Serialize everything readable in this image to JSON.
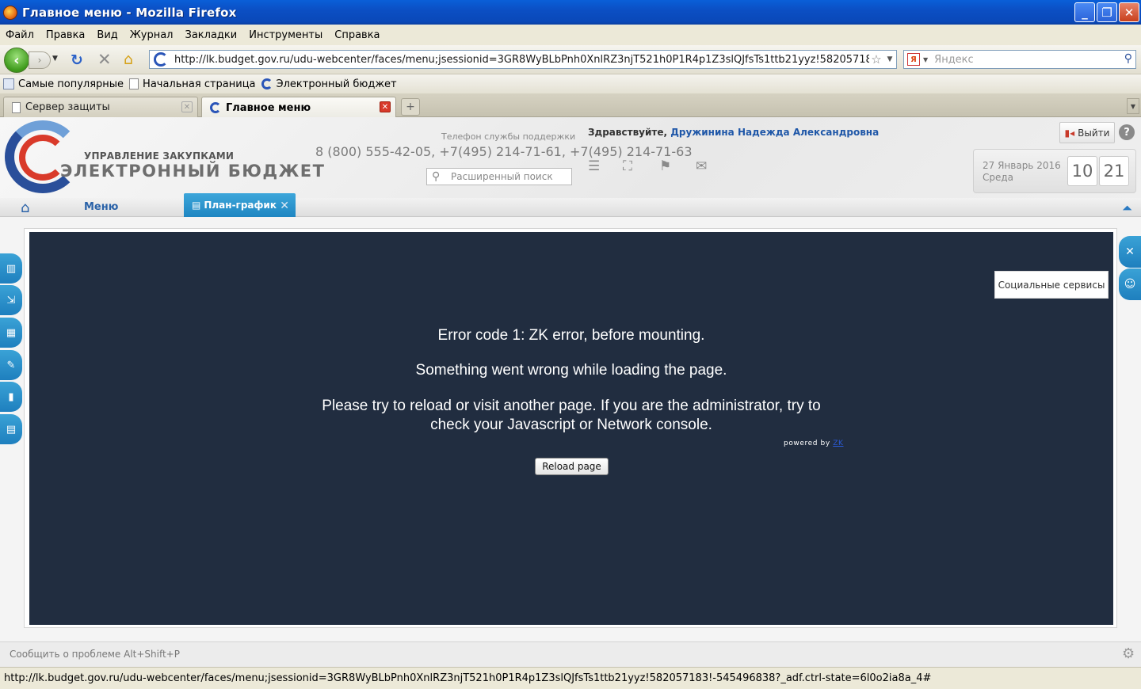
{
  "window": {
    "title": "Главное меню - Mozilla Firefox"
  },
  "menubar": [
    "Файл",
    "Правка",
    "Вид",
    "Журнал",
    "Закладки",
    "Инструменты",
    "Справка"
  ],
  "nav": {
    "url": "http://lk.budget.gov.ru/udu-webcenter/faces/menu;jsessionid=3GR8WyBLbPnh0XnlRZ3njT521h0P1R4p1Z3slQJfsTs1ttb21yyz!582057183!-5",
    "search_placeholder": "Яндекс",
    "search_engine_icon": "Я"
  },
  "bookmarks": [
    "Самые популярные",
    "Начальная страница",
    "Электронный бюджет"
  ],
  "tabs": [
    {
      "label": "Сервер защиты",
      "active": false
    },
    {
      "label": "Главное меню",
      "active": true
    }
  ],
  "app": {
    "brand_line1": "УПРАВЛЕНИЕ ЗАКУПКАМИ",
    "brand_line2": "ЭЛЕКТРОННЫЙ БЮДЖЕТ",
    "support_caption": "Телефон службы поддержки",
    "support_phones": "8 (800) 555-42-05, +7(495) 214-71-61, +7(495) 214-71-63",
    "greeting_prefix": "Здравствуйте,",
    "user_name": "Дружинина Надежда Александровна",
    "adv_search_placeholder": "Расширенный поиск",
    "logout_label": "Выйти",
    "date_line1": "27 Январь 2016",
    "date_line2": "Среда",
    "time_hours": "10",
    "time_minutes": "21",
    "menu_label": "Меню",
    "plan_tab_label": "План-график",
    "social_tooltip": "Социальные сервисы"
  },
  "error": {
    "line1": "Error code 1: ZK error, before mounting.",
    "line2": "Something went wrong while loading the page.",
    "line3a": "Please try to reload or visit another page. If you are the administrator, try to",
    "line3b": "check your Javascript or Network console.",
    "powered_by": "powered by",
    "zk": "ZK",
    "reload_label": "Reload page"
  },
  "report": {
    "text": "Сообщить о проблеме Alt+Shift+P"
  },
  "statusbar": {
    "text": "http://lk.budget.gov.ru/udu-webcenter/faces/menu;jsessionid=3GR8WyBLbPnh0XnlRZ3njT521h0P1R4p1Z3slQJfsTs1ttb21yyz!582057183!-545496838?_adf.ctrl-state=6l0o2ia8a_4#"
  }
}
